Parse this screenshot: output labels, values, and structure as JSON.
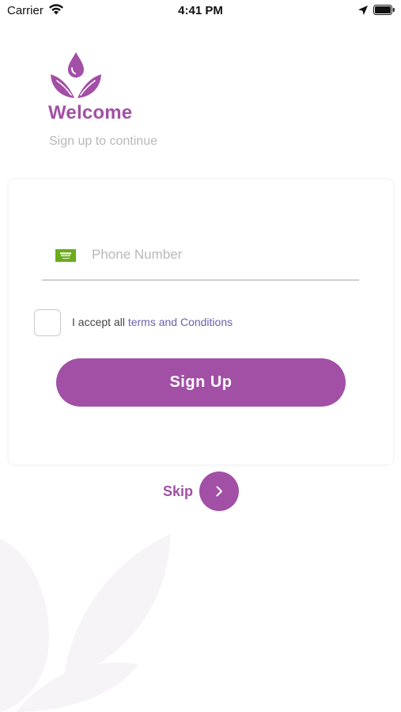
{
  "status_bar": {
    "carrier": "Carrier",
    "time": "4:41 PM",
    "icons": [
      "wifi-icon",
      "location-arrow-icon",
      "battery-icon"
    ]
  },
  "header": {
    "logo_icon": "leaf-drop-logo",
    "title": "Welcome",
    "subtitle": "Sign up to continue"
  },
  "form": {
    "country_flag_icon": "saudi-flag-icon",
    "phone_placeholder": "Phone Number",
    "phone_value": "",
    "checkbox_checked": false,
    "terms_prefix": "I accept all ",
    "terms_link": "terms and Conditions",
    "signup_label": "Sign Up"
  },
  "skip": {
    "label": "Skip",
    "icon": "chevron-right-icon"
  },
  "colors": {
    "brand_purple": "#a24fa6",
    "link_color": "#6a5fb0",
    "placeholder_gray": "#b9b9b9",
    "flag_green": "#6aac1c"
  }
}
